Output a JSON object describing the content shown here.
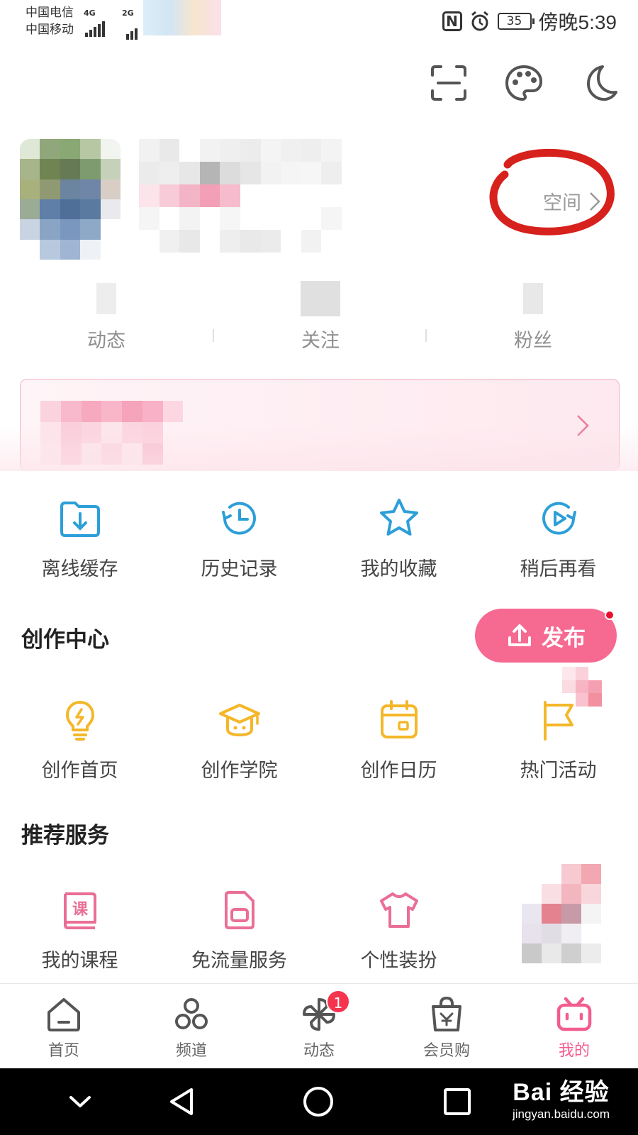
{
  "status_bar": {
    "carrier1": "中国电信",
    "carrier2": "中国移动",
    "net1": "4G",
    "net2": "2G",
    "battery": "35",
    "time": "傍晚5:39"
  },
  "top_actions": [
    "scan-icon",
    "palette-icon",
    "moon-icon"
  ],
  "profile": {
    "space_label": "空间"
  },
  "stats": [
    {
      "label": "动态"
    },
    {
      "label": "关注"
    },
    {
      "label": "粉丝"
    }
  ],
  "quick_actions": [
    {
      "label": "离线缓存",
      "icon": "download-folder-icon"
    },
    {
      "label": "历史记录",
      "icon": "history-clock-icon"
    },
    {
      "label": "我的收藏",
      "icon": "star-icon"
    },
    {
      "label": "稍后再看",
      "icon": "watch-later-icon"
    }
  ],
  "creation": {
    "title": "创作中心",
    "publish_label": "发布",
    "items": [
      {
        "label": "创作首页",
        "icon": "lightbulb-icon"
      },
      {
        "label": "创作学院",
        "icon": "graduation-cap-icon"
      },
      {
        "label": "创作日历",
        "icon": "calendar-icon"
      },
      {
        "label": "热门活动",
        "icon": "flag-icon"
      }
    ]
  },
  "services": {
    "title": "推荐服务",
    "items": [
      {
        "label": "我的课程",
        "icon": "course-book-icon"
      },
      {
        "label": "免流量服务",
        "icon": "sim-card-icon"
      },
      {
        "label": "个性装扮",
        "icon": "tshirt-icon"
      }
    ]
  },
  "course_glyph": "课",
  "tabbar": [
    {
      "label": "首页",
      "icon": "home-icon"
    },
    {
      "label": "频道",
      "icon": "channels-icon"
    },
    {
      "label": "动态",
      "icon": "pinwheel-icon",
      "badge": "1"
    },
    {
      "label": "会员购",
      "icon": "shopping-bag-icon"
    },
    {
      "label": "我的",
      "icon": "tv-mascot-icon",
      "active": true
    }
  ],
  "watermark": {
    "line1": "Bai 经验",
    "line2": "jingyan.baidu.com"
  },
  "colors": {
    "accent_pink": "#f66a92",
    "active_tab": "#f25d8e",
    "blue_icon": "#2d9fd8",
    "yellow_icon": "#f4b72a",
    "pink_icon": "#ea6e95",
    "annotation_red": "#d6211c"
  }
}
